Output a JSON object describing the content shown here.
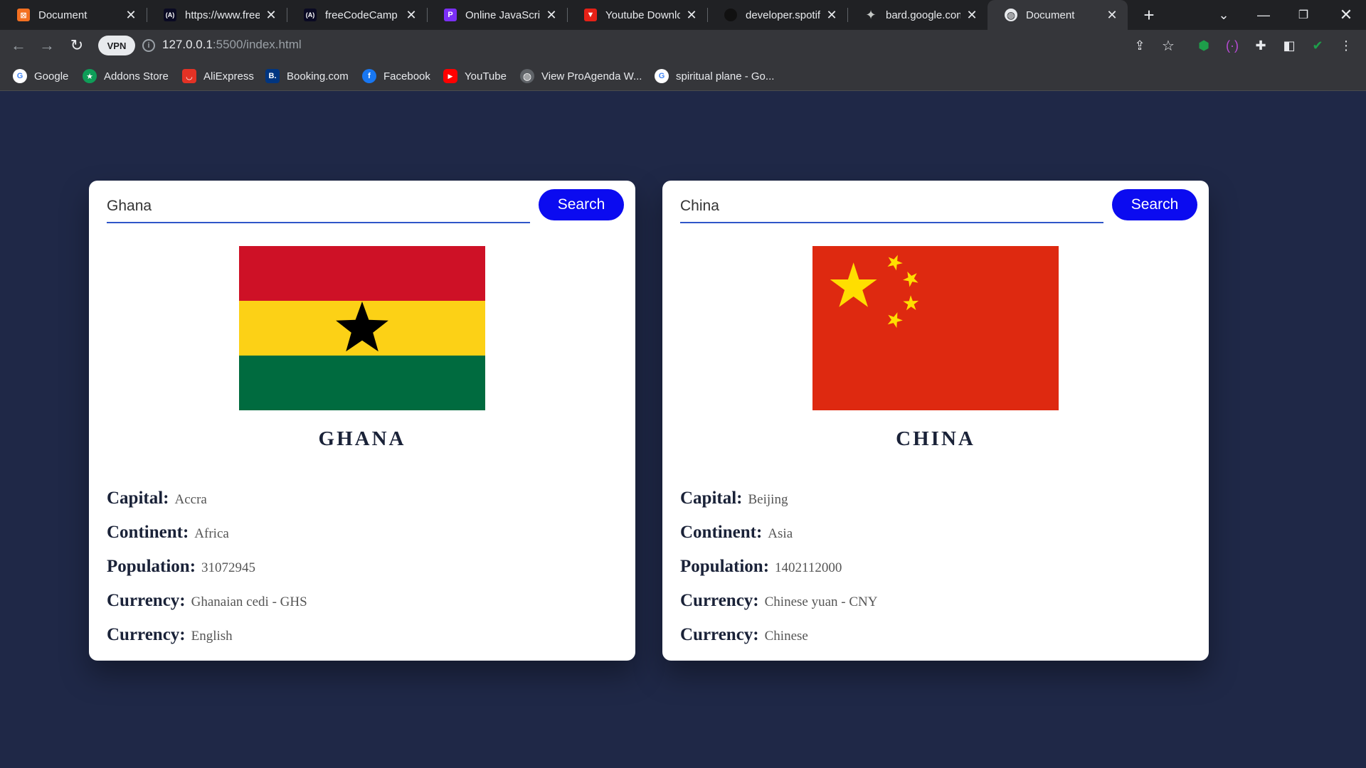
{
  "browser": {
    "tabs": [
      {
        "title": "Document",
        "icon": "xampp-icon",
        "color": "#f37021",
        "glyph": "B"
      },
      {
        "title": "https://www.freeco",
        "icon": "freecodecamp-icon",
        "color": "#0a0a23",
        "glyph": "(A)"
      },
      {
        "title": "freeCodeCamp Ch",
        "icon": "freecodecamp-icon",
        "color": "#0a0a23",
        "glyph": "(A)"
      },
      {
        "title": "Online JavaScript",
        "icon": "playcode-icon",
        "color": "#7b2ff7",
        "glyph": "P"
      },
      {
        "title": "Youtube Downloa",
        "icon": "youtube-downloader-icon",
        "color": "#e62117",
        "glyph": "▼"
      },
      {
        "title": "developer.spotify",
        "icon": "spotify-icon",
        "color": "#111111",
        "glyph": ""
      },
      {
        "title": "bard.google.com",
        "icon": "bard-sparkle-icon",
        "color": "#202124",
        "glyph": "✦"
      },
      {
        "title": "Document",
        "icon": "globe-icon",
        "color": "#35363a",
        "glyph": "◍"
      }
    ],
    "url_host": "127.0.0.1",
    "url_path": ":5500/index.html",
    "vpn_label": "VPN",
    "bookmarks": [
      {
        "label": "Google",
        "icon": "google-icon",
        "color": "#ffffff",
        "glyph": "G"
      },
      {
        "label": "Addons Store",
        "icon": "addons-store-icon",
        "color": "#0f9d58",
        "glyph": "★"
      },
      {
        "label": "AliExpress",
        "icon": "aliexpress-icon",
        "color": "#e43225",
        "glyph": "◡"
      },
      {
        "label": "Booking.com",
        "icon": "booking-icon",
        "color": "#003580",
        "glyph": "B."
      },
      {
        "label": "Facebook",
        "icon": "facebook-icon",
        "color": "#1877f2",
        "glyph": "f"
      },
      {
        "label": "YouTube",
        "icon": "youtube-icon",
        "color": "#ff0000",
        "glyph": "▶"
      },
      {
        "label": "View ProAgenda W...",
        "icon": "globe-icon",
        "color": "#5f6368",
        "glyph": "◍"
      },
      {
        "label": "spiritual plane - Go...",
        "icon": "google-icon",
        "color": "#ffffff",
        "glyph": "G"
      }
    ]
  },
  "cards": [
    {
      "search_value": "Ghana",
      "search_label": "Search",
      "flag": "ghana",
      "flag_colors": {
        "red": "#ce1126",
        "gold": "#fcd116",
        "green": "#006b3f",
        "star": "#000000"
      },
      "name": "GHANA",
      "capital_label": "Capital:",
      "capital": "Accra",
      "continent_label": "Continent:",
      "continent": "Africa",
      "population_label": "Population:",
      "population": "31072945",
      "currency_label": "Currency:",
      "currency": "Ghanaian cedi - GHS",
      "language_label": "Currency:",
      "language": "English"
    },
    {
      "search_value": "China",
      "search_label": "Search",
      "flag": "china",
      "flag_colors": {
        "red": "#de2910",
        "star": "#ffde00"
      },
      "name": "CHINA",
      "capital_label": "Capital:",
      "capital": "Beijing",
      "continent_label": "Continent:",
      "continent": "Asia",
      "population_label": "Population:",
      "population": "1402112000",
      "currency_label": "Currency:",
      "currency": "Chinese yuan - CNY",
      "language_label": "Currency:",
      "language": "Chinese"
    }
  ]
}
